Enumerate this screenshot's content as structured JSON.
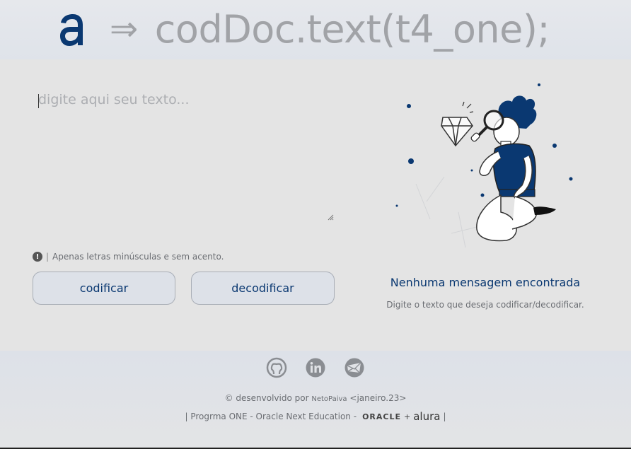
{
  "header": {
    "arrow": "⇒",
    "brand_title": "codDoc.text(t4_one);"
  },
  "editor": {
    "placeholder": "digite aqui seu texto...",
    "value": ""
  },
  "hint": {
    "text": "Apenas letras minúsculas e sem acento."
  },
  "actions": {
    "encode_label": "codificar",
    "decode_label": "decodificar"
  },
  "output": {
    "empty_title": "Nenhuma mensagem encontrada",
    "empty_subtitle": "Digite o texto que deseja codificar/decodificar."
  },
  "footer": {
    "social": [
      "github-icon",
      "linkedin-icon",
      "email-icon"
    ],
    "credits_prefix": "© desenvolvido por",
    "credits_author": "NetoPaiva",
    "credits_suffix": "<janeiro.23>",
    "program_text": "| Progrma ONE - Oracle Next Education -",
    "oracle_label": "ORACLE",
    "plus": "+",
    "alura_label": "alura",
    "program_end": "|"
  },
  "colors": {
    "accent": "#0a3871",
    "background": "#e4e4e4",
    "muted_text": "#6a6d72",
    "brand_text": "#a1a3a7"
  }
}
